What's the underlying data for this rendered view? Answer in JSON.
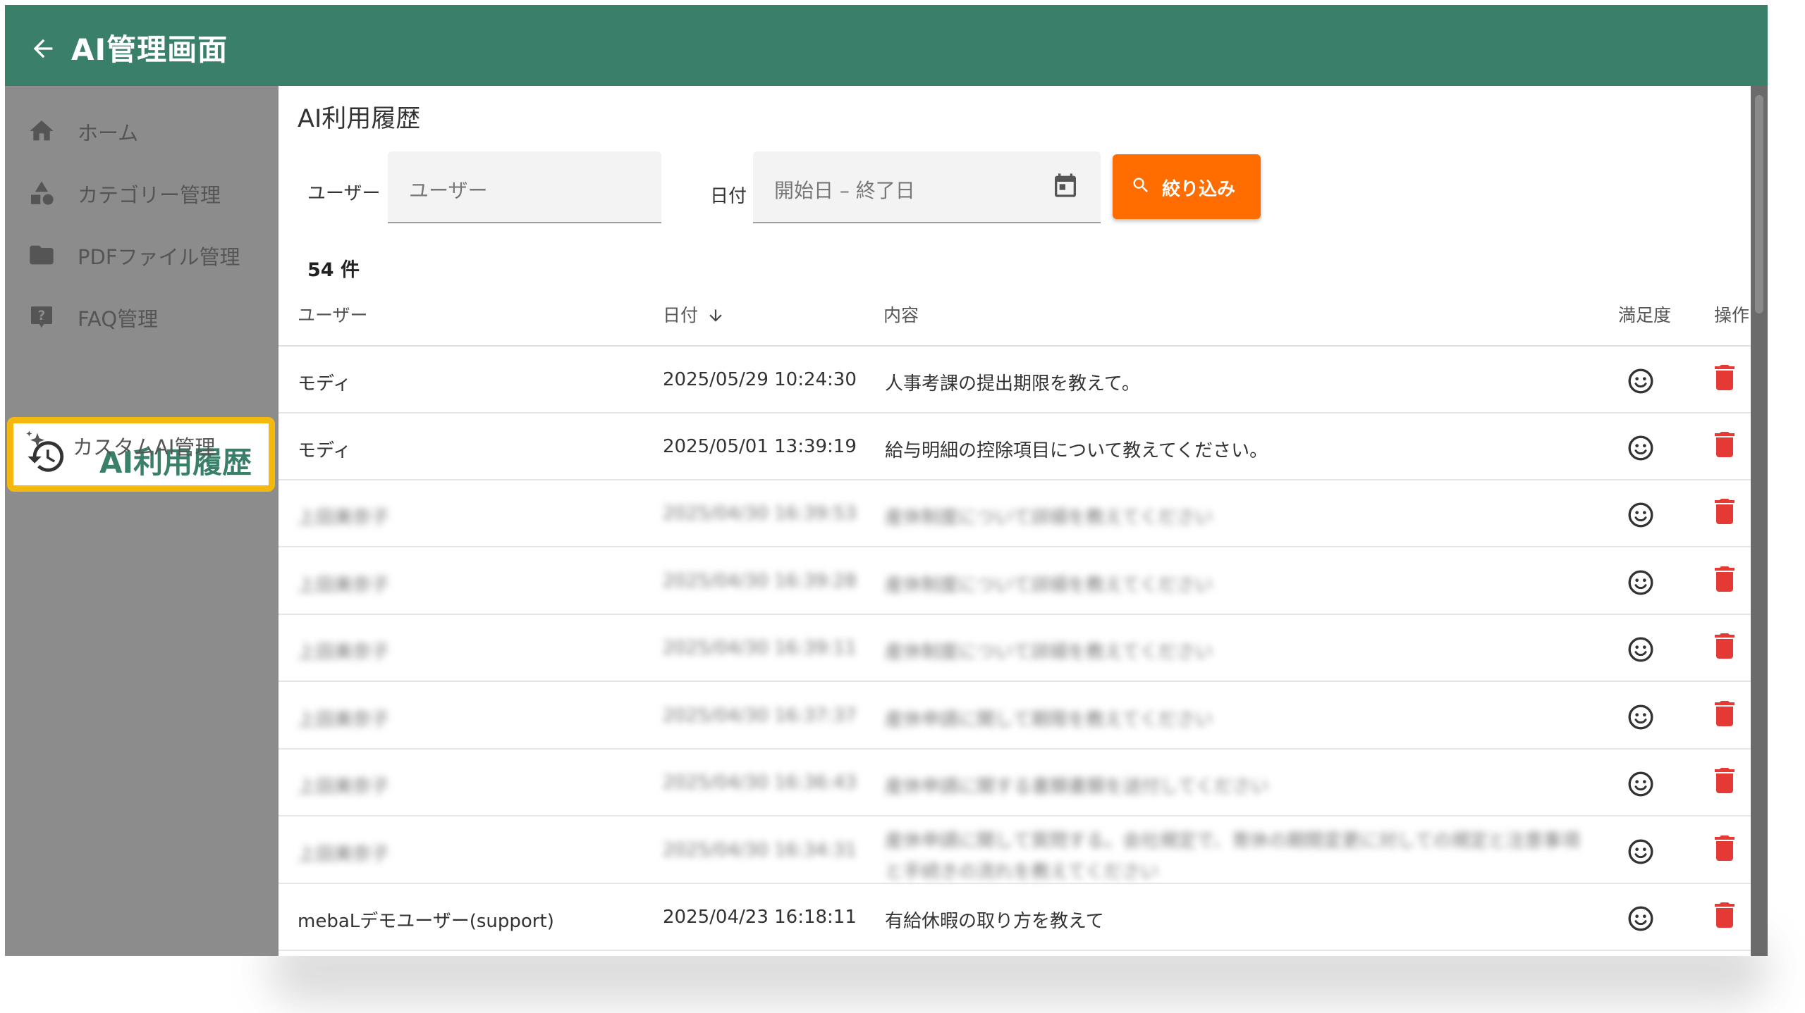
{
  "app": {
    "title": "AI管理画面"
  },
  "sidebar": {
    "items": [
      {
        "label": "ホーム",
        "icon": "home-icon"
      },
      {
        "label": "カテゴリー管理",
        "icon": "category-icon"
      },
      {
        "label": "PDFファイル管理",
        "icon": "folder-icon"
      },
      {
        "label": "FAQ管理",
        "icon": "help-icon"
      },
      {
        "label": "AI利用履歴",
        "icon": "history-icon",
        "active": true
      },
      {
        "label": "カスタムAI管理",
        "icon": "sparkle-icon"
      }
    ]
  },
  "page": {
    "title": "AI利用履歴"
  },
  "filters": {
    "user_label": "ユーザー",
    "user_placeholder": "ユーザー",
    "date_label": "日付",
    "date_placeholder": "開始日 – 終了日",
    "button_label": "絞り込み"
  },
  "results": {
    "count": "54 件"
  },
  "table": {
    "columns": {
      "user": "ユーザー",
      "date": "日付",
      "content": "内容",
      "satisfaction": "満足度",
      "actions": "操作"
    },
    "rows": [
      {
        "user": "モディ",
        "date": "2025/05/29 10:24:30",
        "content": "人事考課の提出期限を教えて。",
        "blurred": false
      },
      {
        "user": "モディ",
        "date": "2025/05/01 13:39:19",
        "content": "給与明細の控除項目について教えてください。",
        "blurred": false
      },
      {
        "user": "上田美奈子",
        "date": "2025/04/30 16:39:53",
        "content": "産休制度について詳細を教えてください",
        "blurred": true
      },
      {
        "user": "上田美奈子",
        "date": "2025/04/30 16:39:28",
        "content": "産休制度について詳細を教えてください",
        "blurred": true
      },
      {
        "user": "上田美奈子",
        "date": "2025/04/30 16:39:11",
        "content": "産休制度について詳細を教えてください",
        "blurred": true
      },
      {
        "user": "上田美奈子",
        "date": "2025/04/30 16:37:37",
        "content": "産休申請に関して期限を教えてください",
        "blurred": true
      },
      {
        "user": "上田美奈子",
        "date": "2025/04/30 16:36:43",
        "content": "産休申請に関する書類書類を送付してください",
        "blurred": true
      },
      {
        "user": "上田美奈子",
        "date": "2025/04/30 16:34:31",
        "content": "産休申請に関して質問する。会社規定で、育休の期間変更に対しての規定と注意事項と手続きの流れを教えてください",
        "blurred": true
      },
      {
        "user": "mebaLデモユーザー(support)",
        "date": "2025/04/23 16:18:11",
        "content": "有給休暇の取り方を教えて",
        "blurred": false
      }
    ]
  },
  "colors": {
    "primary": "#3a7f69",
    "accent": "#ff6d00",
    "highlight": "#f5b80d",
    "danger": "#e53935"
  }
}
